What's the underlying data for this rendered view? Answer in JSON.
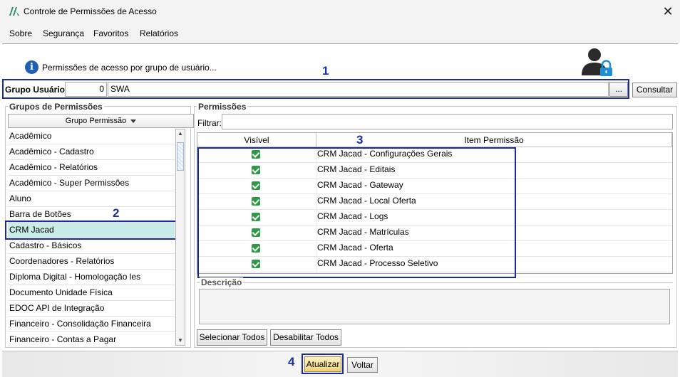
{
  "window": {
    "title": "Controle de Permissões de Acesso",
    "close_glyph": "✕"
  },
  "menu": [
    {
      "label": "Sobre"
    },
    {
      "label": "Segurança"
    },
    {
      "label": "Favoritos"
    },
    {
      "label": "Relatórios"
    }
  ],
  "header": {
    "info_icon": "i",
    "info_text": "Permissões de acesso por grupo de usuário..."
  },
  "markers": [
    "1",
    "2",
    "3",
    "4"
  ],
  "group_user": {
    "label": "Grupo Usuário:",
    "code": "0",
    "name": "SWA",
    "ellipsis_label": "...",
    "consult_label": "Consultar"
  },
  "groups": {
    "title": "Grupos de Permissões",
    "column_header": "Grupo Permissão",
    "items": [
      "Acadêmico",
      "Acadêmico - Cadastro",
      "Acadêmico - Relatórios",
      "Acadêmico - Super Permissões",
      "Aluno",
      "Barra de Botões",
      "CRM Jacad",
      "Cadastro - Básicos",
      "Coordenadores - Relatórios",
      "Diploma Digital - Homologação les",
      "Documento Unidade Física",
      "EDOC API de Integração",
      "Financeiro - Consolidação Financeira",
      "Financeiro - Contas a Pagar"
    ],
    "selected": "CRM Jacad"
  },
  "permissions": {
    "title": "Permissões",
    "filter_label": "Filtrar:",
    "filter_value": "",
    "columns": [
      "Visível",
      "Item Permissão"
    ],
    "rows": [
      {
        "visible": true,
        "item": "CRM Jacad - Configurações Gerais"
      },
      {
        "visible": true,
        "item": "CRM Jacad - Editais"
      },
      {
        "visible": true,
        "item": "CRM Jacad - Gateway"
      },
      {
        "visible": true,
        "item": "CRM Jacad - Local Oferta"
      },
      {
        "visible": true,
        "item": "CRM Jacad - Logs"
      },
      {
        "visible": true,
        "item": "CRM Jacad - Matrículas"
      },
      {
        "visible": true,
        "item": "CRM Jacad - Oferta"
      },
      {
        "visible": true,
        "item": "CRM Jacad - Processo Seletivo"
      }
    ],
    "description_title": "Descrição",
    "select_all_label": "Selecionar Todos",
    "disable_all_label": "Desabilitar Todos"
  },
  "footer": {
    "update_label": "Atualizar",
    "back_label": "Voltar"
  },
  "colors": {
    "marker": "#1a2fa6",
    "selected_row": "#c9ece8",
    "check": "#2e9a46",
    "update_button": "#f0d27a"
  }
}
